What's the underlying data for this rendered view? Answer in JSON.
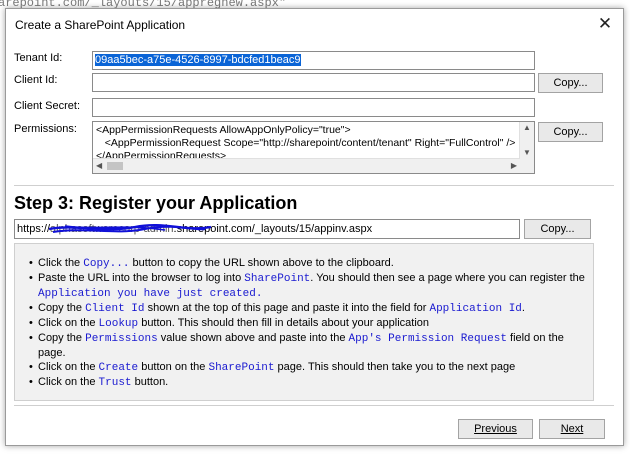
{
  "background": {
    "lines": [
      "arepoint.com/_layouts/15/appregnew.aspx\""
    ]
  },
  "dialog": {
    "title": "Create a SharePoint Application",
    "close_glyph": "✕"
  },
  "fields": {
    "tenant_id_label": "Tenant Id:",
    "tenant_id_value": "09aa5bec-a75e-4526-8997-bdcfed1beac9",
    "client_id_label": "Client Id:",
    "client_id_value": "",
    "client_secret_label": "Client Secret:",
    "client_secret_value": "",
    "permissions_label": "Permissions:",
    "permissions_lines": [
      "<AppPermissionRequests AllowAppOnlyPolicy=\"true\">",
      "   <AppPermissionRequest Scope=\"http://sharepoint/content/tenant\" Right=\"FullControl\" />",
      "</AppPermissionRequests>"
    ],
    "copy_label": "Copy..."
  },
  "step": {
    "title": "Step 3: Register your Application",
    "url_prefix": "https://",
    "url_redacted": "alphasoftwarecorp-admin",
    "url_suffix": ".sharepoint.com/_layouts/15/appinv.aspx",
    "copy_label": "Copy..."
  },
  "instructions": [
    [
      {
        "t": "Click the "
      },
      {
        "c": "Copy..."
      },
      {
        "t": " button to copy the URL shown above to the clipboard."
      }
    ],
    [
      {
        "t": "Paste the URL into the browser to log into "
      },
      {
        "c": "SharePoint"
      },
      {
        "t": ". You should then see a page where you can register the "
      },
      {
        "c": "Application you have just created."
      }
    ],
    [
      {
        "t": "Copy the "
      },
      {
        "c": "Client Id"
      },
      {
        "t": " shown at the top of this page and paste it into the field for "
      },
      {
        "c": "Application Id"
      },
      {
        "t": "."
      }
    ],
    [
      {
        "t": "Click on the "
      },
      {
        "c": "Lookup"
      },
      {
        "t": " button. This should then fill in details about your application"
      }
    ],
    [
      {
        "t": "Copy the "
      },
      {
        "c": "Permissions"
      },
      {
        "t": " value shown above and paste into the "
      },
      {
        "c": "App's Permission Request"
      },
      {
        "t": " field on the page."
      }
    ],
    [
      {
        "t": "Click on the "
      },
      {
        "c": "Create"
      },
      {
        "t": " button on the "
      },
      {
        "c": "SharePoint"
      },
      {
        "t": " page. This should then take you to the next page"
      }
    ],
    [
      {
        "t": "Click on the "
      },
      {
        "c": "Trust"
      },
      {
        "t": " button."
      }
    ]
  ],
  "footer": {
    "previous_label": "Previous",
    "next_label": "Next"
  }
}
